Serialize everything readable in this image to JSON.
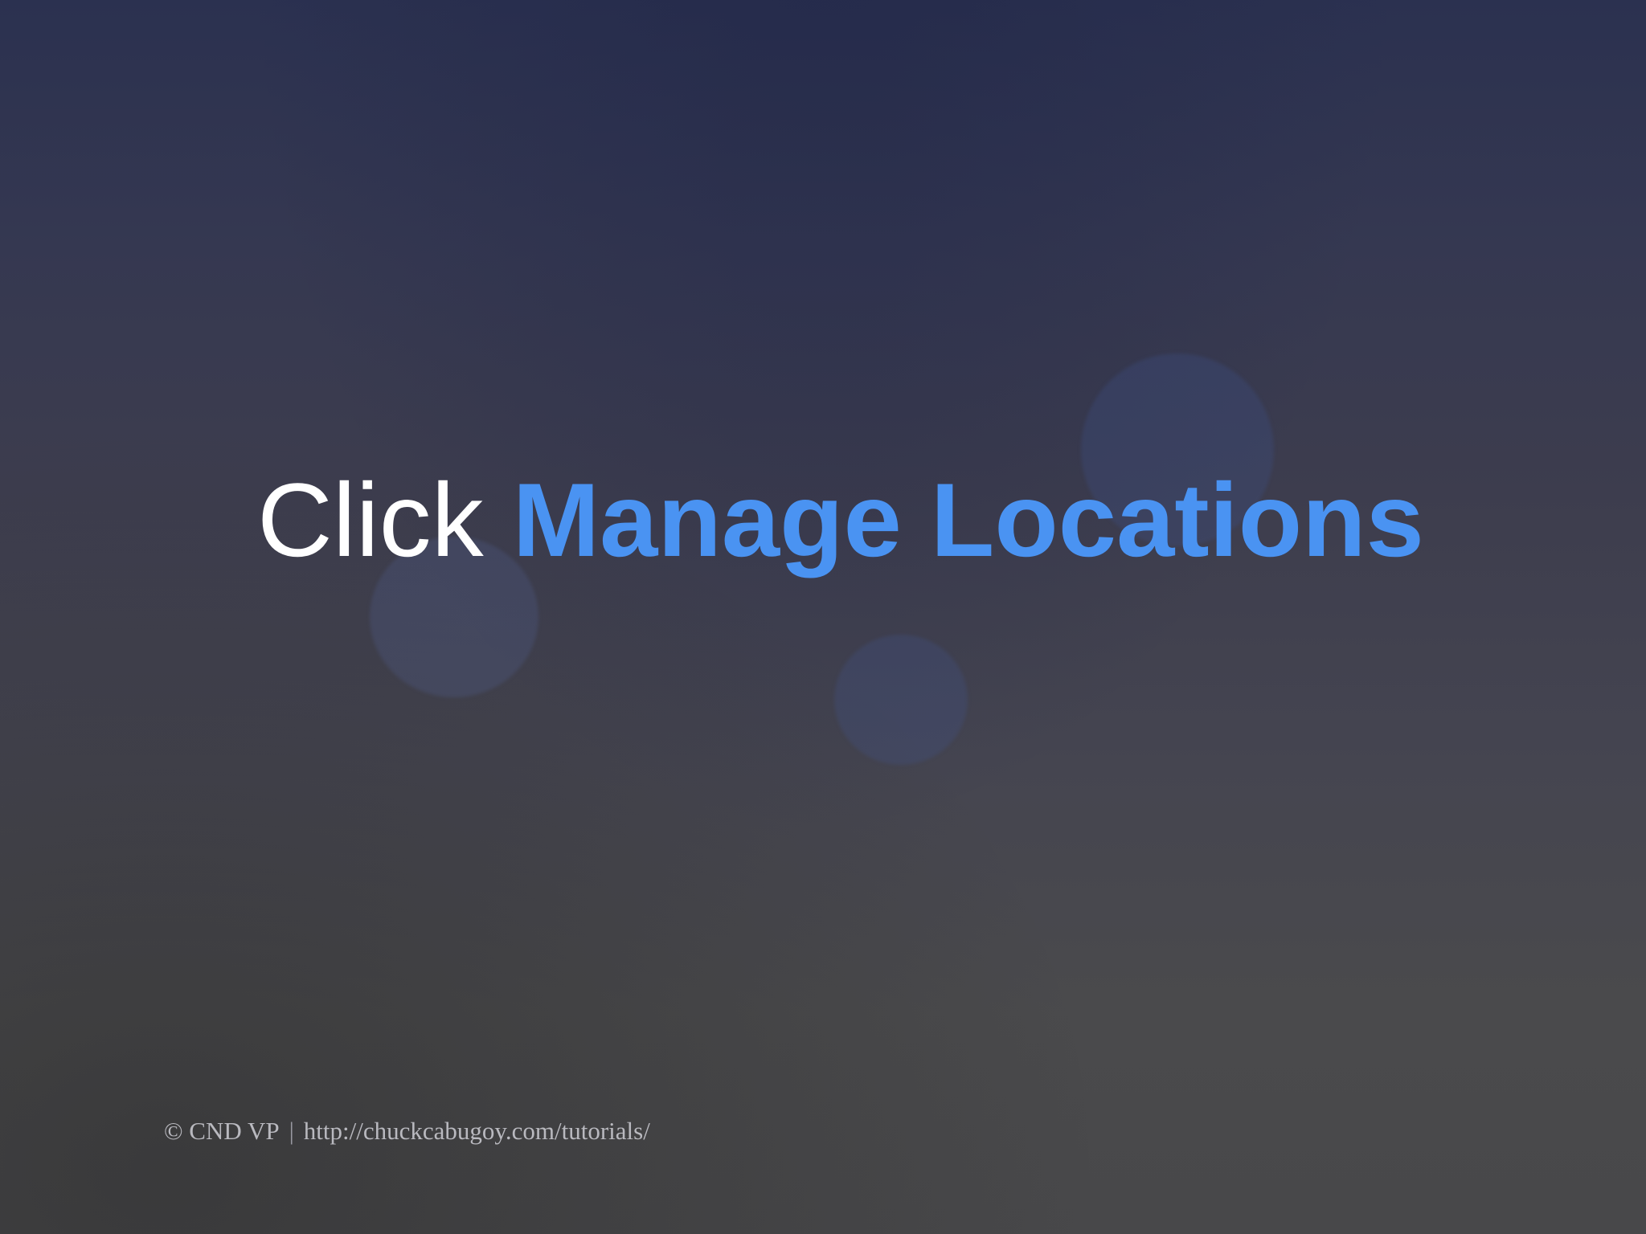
{
  "headline": {
    "lead": "Click",
    "target": "Manage Locations"
  },
  "footer": {
    "copyright": "© CND VP",
    "separator": "|",
    "url": "http://chuckcabugoy.com/tutorials/"
  },
  "colors": {
    "accent": "#4a93f2",
    "headline_text": "#ffffff",
    "footer_text": "#b9b9bf"
  }
}
